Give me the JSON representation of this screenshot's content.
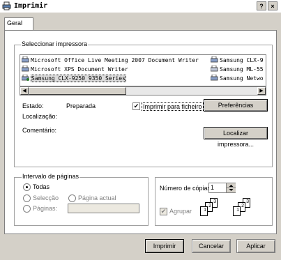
{
  "window": {
    "title": "Imprimir",
    "help": "?",
    "close": "×"
  },
  "tab": {
    "label": "Geral"
  },
  "printer_group": {
    "legend": "Seleccionar impressora",
    "printers_col1": [
      "Microsoft Office Live Meeting 2007 Document Writer",
      "Microsoft XPS Document Writer",
      "Samsung CLX-9250 9350 Series"
    ],
    "printers_col2": [
      "Samsung CLX-9",
      "Samsung ML-55",
      "Samsung Netwo"
    ],
    "status_label": "Estado:",
    "status_value": "Preparada",
    "location_label": "Localização:",
    "comment_label": "Comentário:",
    "print_to_file": "Imprimir para ficheiro",
    "print_to_file_checked": "✔",
    "preferences": "Preferências",
    "find_printer": "Localizar impressora...",
    "scroll_left": "◀",
    "scroll_right": "▶"
  },
  "range_group": {
    "legend": "Intervalo de páginas",
    "all": "Todas",
    "selection": "Selecção",
    "current": "Página actual",
    "pages": "Páginas:"
  },
  "copies_group": {
    "copies_label": "Número de cópias:",
    "copies_value": "1",
    "collate": "Agrupar",
    "collate_checked": "✔",
    "page_nums": [
      "1",
      "2",
      "3"
    ]
  },
  "buttons": {
    "print": "Imprimir",
    "cancel": "Cancelar",
    "apply": "Aplicar"
  }
}
